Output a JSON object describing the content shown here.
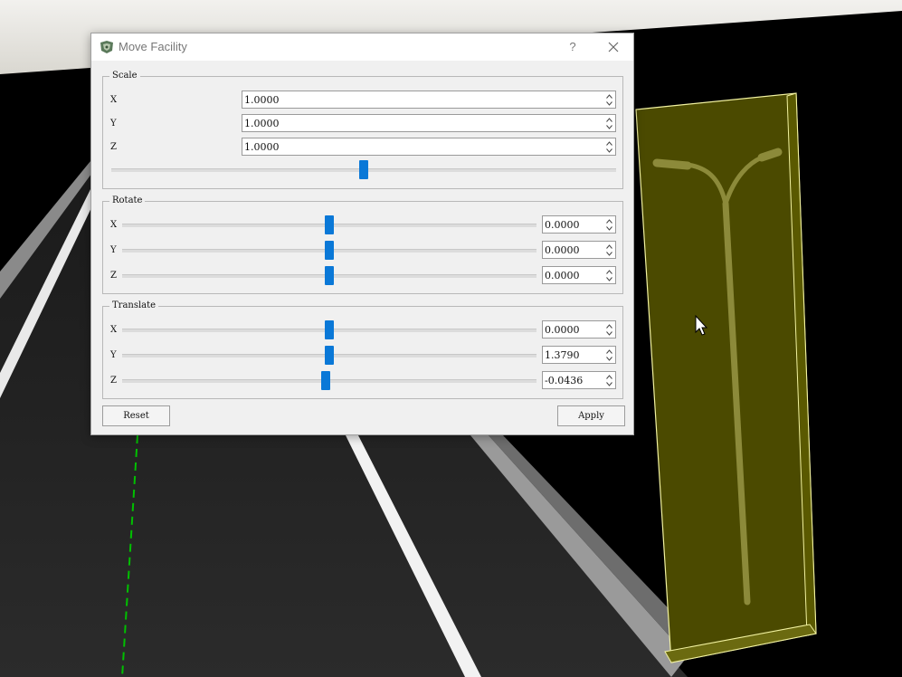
{
  "dialog": {
    "title": "Move Facility",
    "help_label": "?"
  },
  "scale": {
    "group_title": "Scale",
    "fields": [
      {
        "axis": "X",
        "value": "1.0000"
      },
      {
        "axis": "Y",
        "value": "1.0000"
      },
      {
        "axis": "Z",
        "value": "1.0000"
      }
    ],
    "slider_level": 0.5
  },
  "rotate": {
    "group_title": "Rotate",
    "rows": [
      {
        "axis": "X",
        "value": "0.0000",
        "slider_level": 0.5
      },
      {
        "axis": "Y",
        "value": "0.0000",
        "slider_level": 0.5
      },
      {
        "axis": "Z",
        "value": "0.0000",
        "slider_level": 0.5
      }
    ]
  },
  "translate": {
    "group_title": "Translate",
    "rows": [
      {
        "axis": "X",
        "value": "0.0000",
        "slider_level": 0.5
      },
      {
        "axis": "Y",
        "value": "1.3790",
        "slider_level": 0.5
      },
      {
        "axis": "Z",
        "value": "-0.0436",
        "slider_level": 0.49
      }
    ]
  },
  "buttons": {
    "reset_label": "Reset",
    "apply_label": "Apply"
  },
  "colors": {
    "accent": "#0a78d7",
    "selection_fill": "#4b4a00",
    "lane_marking": "#ffffff",
    "guide_line": "#00c000"
  },
  "icons": {
    "app": "app-logo-icon",
    "close": "close-icon",
    "cursor": "mouse-pointer-icon"
  }
}
